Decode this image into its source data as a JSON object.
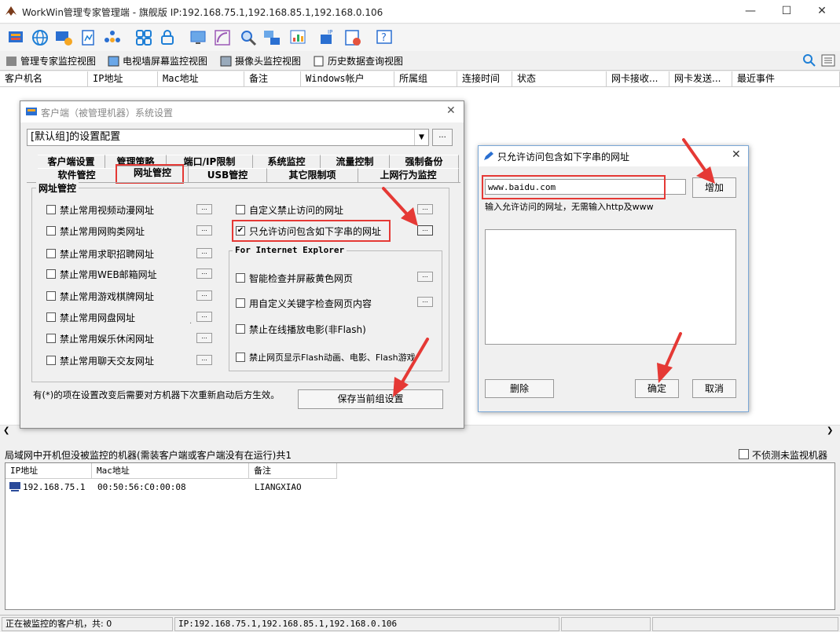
{
  "window": {
    "title": "WorkWin管理专家管理端 - 旗舰版 IP:192.168.75.1,192.168.85.1,192.168.0.106",
    "minimize": "—",
    "maximize": "☐",
    "close": "✕"
  },
  "view_tabs": [
    "管理专家监控视图",
    "电视墙屏幕监控视图",
    "摄像头监控视图",
    "历史数据查询视图"
  ],
  "main_columns": [
    "客户机名",
    "IP地址",
    "Mac地址",
    "备注",
    "Windows帐户",
    "所属组",
    "连接时间",
    "状态",
    "网卡接收...",
    "网卡发送...",
    "最近事件"
  ],
  "settings_dialog": {
    "title": "客户端（被管理机器）系统设置",
    "config_combo": "[默认组]的设置配置",
    "browse_btn": "...",
    "tabs_row1": [
      "客户端设置",
      "管理策略",
      "端口/IP限制",
      "系统监控",
      "流量控制",
      "强制备份"
    ],
    "tabs_row2": [
      "软件管控",
      "网址管控",
      "USB管控",
      "其它限制项",
      "上网行为监控"
    ],
    "group_label": "网址管控",
    "left_items": [
      {
        "label": "禁止常用视频动漫网址",
        "checked": false
      },
      {
        "label": "禁止常用网购类网址",
        "checked": false
      },
      {
        "label": "禁止常用求职招聘网址",
        "checked": false
      },
      {
        "label": "禁止常用WEB邮箱网址",
        "checked": false
      },
      {
        "label": "禁止常用游戏棋牌网址",
        "checked": false
      },
      {
        "label": "禁止常用网盘网址",
        "checked": false
      },
      {
        "label": "禁止常用娱乐休闲网址",
        "checked": false
      },
      {
        "label": "禁止常用聊天交友网址",
        "checked": false
      }
    ],
    "right_items": [
      {
        "label": "自定义禁止访问的网址",
        "checked": false
      },
      {
        "label": "只允许访问包含如下字串的网址",
        "checked": true
      }
    ],
    "ie_group_label": "For Internet Explorer",
    "ie_items": [
      {
        "label": "智能检查并屏蔽黄色网页",
        "checked": false
      },
      {
        "label": "用自定义关键字检查网页内容",
        "checked": false
      },
      {
        "label": "禁止在线播放电影(非Flash)",
        "checked": false
      },
      {
        "label": "禁止网页显示Flash动画、电影、Flash游戏",
        "checked": false
      }
    ],
    "note": "有(*)的项在设置改变后需要对方机器下次重新启动后方生效。",
    "save_btn": "保存当前组设置",
    "check_mark": "✔",
    "small_btn": "...",
    "dot": "·"
  },
  "url_dialog": {
    "title": "只允许访问包含如下字串的网址",
    "url_value": "www.baidu.com",
    "add_btn": "增加",
    "hint": "输入允许访问的网址，无需输入http及www",
    "delete_btn": "删除",
    "ok_btn": "确定",
    "cancel_btn": "取消",
    "close": "✕"
  },
  "lan_panel": {
    "label": "局域网中开机但没被监控的机器(需装客户端或客户端没有在运行)共1",
    "no_detect_label": "不侦测未监视机器",
    "columns": [
      "IP地址",
      "Mac地址",
      "备注"
    ],
    "rows": [
      {
        "ip": "192.168.75.1",
        "mac": "00:50:56:C0:00:08",
        "note": "LIANGXIAO"
      }
    ]
  },
  "status_bar": {
    "left": "正在被监控的客户机，共: 0",
    "middle": "IP:192.168.75.1,192.168.85.1,192.168.0.106"
  },
  "scroll": {
    "left": "❮",
    "right": "❯"
  },
  "colors": {
    "accent_red": "#e53935",
    "arrow_red": "#e53935"
  }
}
